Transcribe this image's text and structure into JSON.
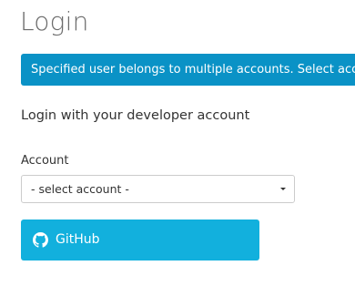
{
  "page": {
    "title": "Login"
  },
  "alert": {
    "message": "Specified user belongs to multiple accounts. Select account",
    "color": "#0a92c6"
  },
  "subtitle": "Login with your developer account",
  "account": {
    "label": "Account",
    "selected": "- select account -"
  },
  "github_button": {
    "label": "GitHub",
    "icon": "github-icon",
    "color": "#12b0dd"
  }
}
